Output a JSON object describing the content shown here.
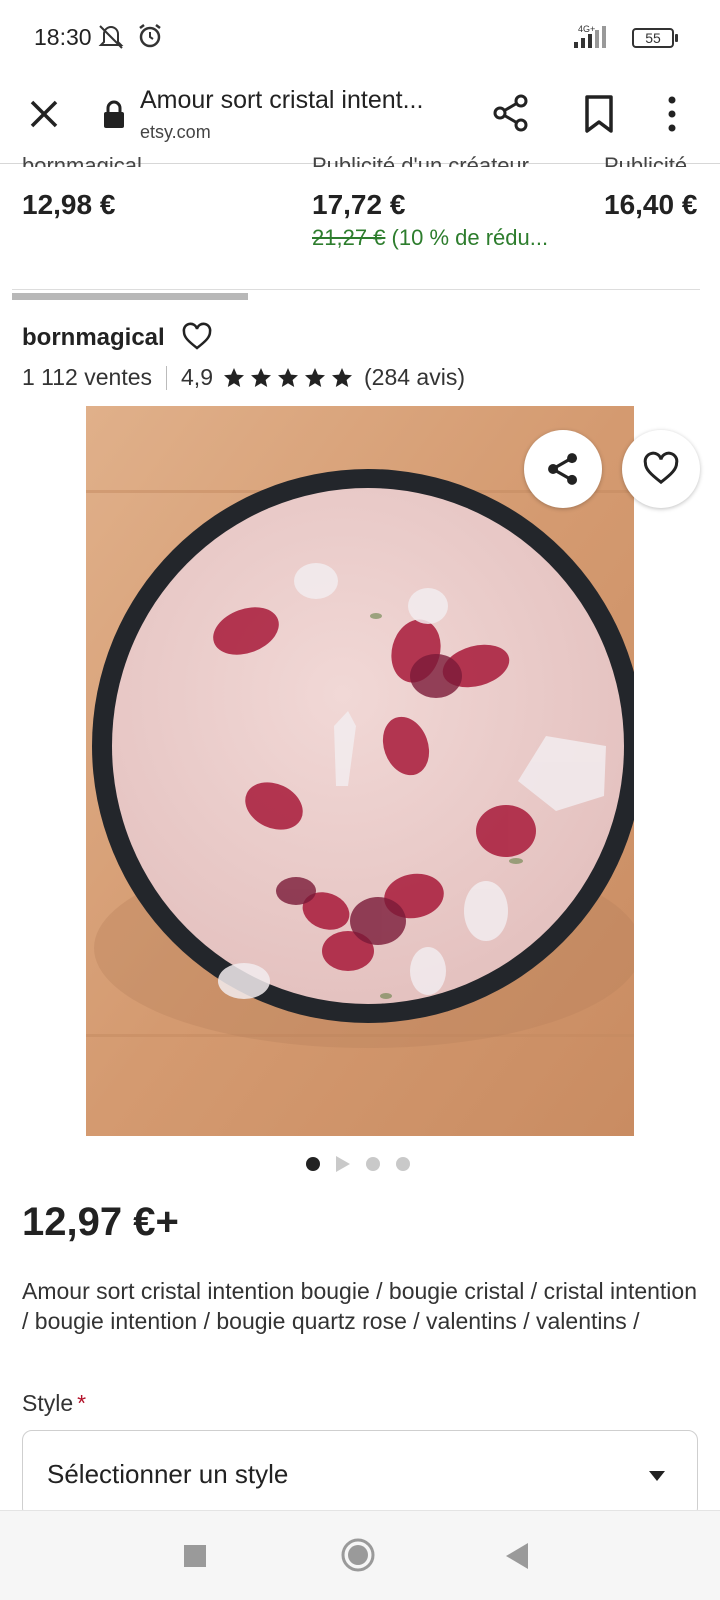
{
  "status_bar": {
    "time": "18:30",
    "network": "4G+",
    "battery": "55"
  },
  "browser": {
    "title": "Amour sort cristal intent...",
    "domain": "etsy.com"
  },
  "recommendations": [
    {
      "seller_cut": "bornmagical",
      "price": "12,98 €"
    },
    {
      "seller_cut": "Publicité d'un créateur",
      "price": "17,72 €",
      "old_price": "21,27 €",
      "discount": "(10 % de rédu..."
    },
    {
      "seller_cut": "Publicité",
      "price": "16,40 €"
    }
  ],
  "shop": {
    "name": "bornmagical",
    "sales": "1 112 ventes",
    "rating": "4,9",
    "rating_stars": 5,
    "reviews": "(284 avis)"
  },
  "carousel": {
    "slide_count": 4,
    "active_index": 0
  },
  "product": {
    "price": "12,97 €+",
    "title": "Amour sort cristal intention bougie / bougie cristal / cristal intention / bougie intention / bougie quartz rose / valentins / valentins /"
  },
  "style_field": {
    "label": "Style",
    "required_mark": "*",
    "value": "Sélectionner un style"
  },
  "colors": {
    "text": "#222222",
    "discount_green": "#2d7d2d",
    "required_red": "#b3122a"
  },
  "icons": {
    "close": "close-icon",
    "lock": "lock-icon",
    "share": "share-icon",
    "bookmark": "bookmark-icon",
    "menu": "more-vert-icon",
    "favorite": "heart-icon"
  }
}
